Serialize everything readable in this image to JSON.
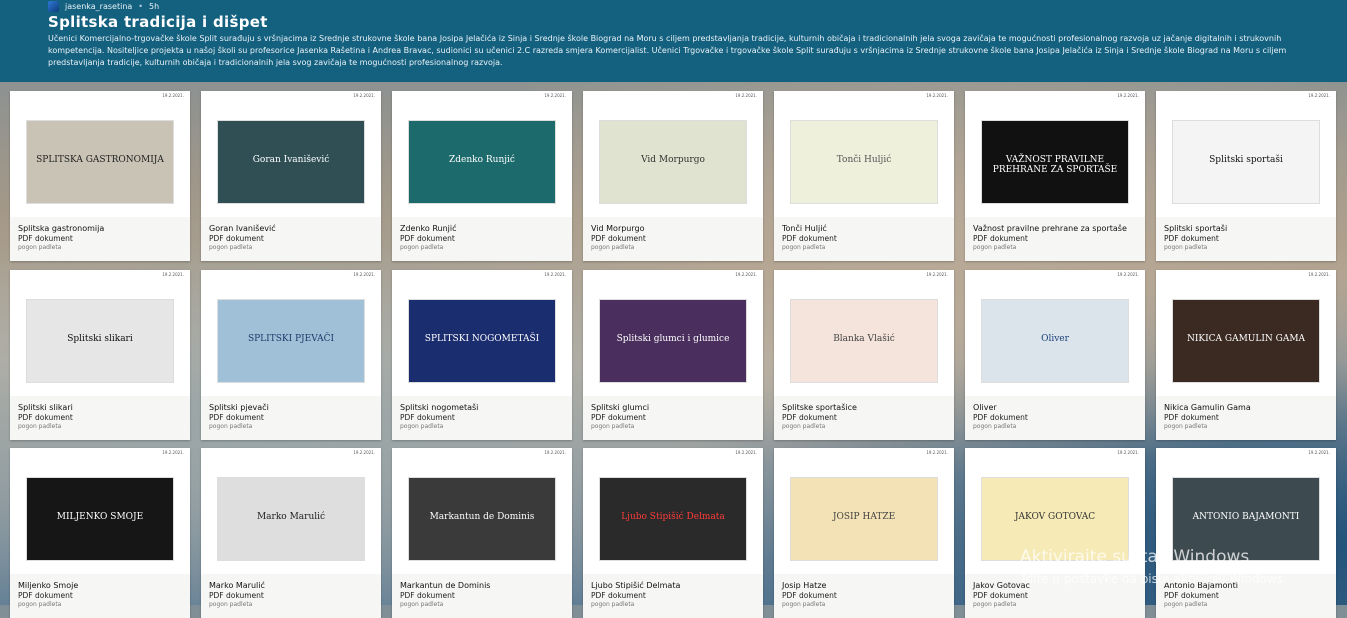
{
  "header": {
    "author": "jasenka_rasetina",
    "time": "5h",
    "title": "Splitska tradicija i dišpet",
    "description": "Učenici Komercijalno-trgovačke škole Split surađuju s vršnjacima iz Srednje strukovne škole bana Josipa Jelačića iz Sinja i Srednje škole Biograd na Moru s ciljem predstavljanja tradicije, kulturnih običaja i tradicionalnih jela svoga zavičaja te mogućnosti profesionalnog razvoja uz jačanje digitalnih i strukovnih kompetencija. Nositeljice projekta u našoj školi su profesorice Jasenka Rašetina i Andrea Bravac, sudionici su učenici 2.C razreda smjera Komercijalist. Učenici Trgovačke i trgovačke škole Split surađuju s vršnjacima iz Srednje strukovne škole bana Josipa Jelačića iz Sinja i Srednje škole Biograd na Moru s ciljem predstavljanja tradicije, kulturnih običaja i tradicionalnih jela svog zavičaja te mogućnosti profesionalnog razvoja."
  },
  "cards": [
    {
      "title": "Splitska gastronomija",
      "type": "PDF dokument",
      "source": "pogon padleta",
      "date": "19.2.2021.",
      "thumb_text": "SPLITSKA GASTRONOMIJA",
      "thumb_bg": "#c9c3b5",
      "thumb_fg": "#222"
    },
    {
      "title": "Goran Ivanišević",
      "type": "PDF dokument",
      "source": "pogon padleta",
      "date": "19.2.2021.",
      "thumb_text": "Goran Ivanišević",
      "thumb_bg": "#2f4f55",
      "thumb_fg": "#fff"
    },
    {
      "title": "Zdenko Runjić",
      "type": "PDF dokument",
      "source": "pogon padleta",
      "date": "19.2.2021.",
      "thumb_text": "Zdenko Runjić",
      "thumb_bg": "#1d6a6c",
      "thumb_fg": "#fff"
    },
    {
      "title": "Vid Morpurgo",
      "type": "PDF dokument",
      "source": "pogon padleta",
      "date": "19.2.2021.",
      "thumb_text": "Vid Morpurgo",
      "thumb_bg": "#dfe3cf",
      "thumb_fg": "#333"
    },
    {
      "title": "Tonči Huljić",
      "type": "PDF dokument",
      "source": "pogon padleta",
      "date": "19.2.2021.",
      "thumb_text": "Tonči Huljić",
      "thumb_bg": "#eef0dc",
      "thumb_fg": "#555"
    },
    {
      "title": "Važnost pravilne prehrane za sportaše",
      "type": "PDF dokument",
      "source": "pogon padleta",
      "date": "19.2.2021.",
      "thumb_text": "VAŽNOST PRAVILNE PREHRANE ZA SPORTAŠE",
      "thumb_bg": "#111",
      "thumb_fg": "#fff"
    },
    {
      "title": "Splitski sportaši",
      "type": "PDF dokument",
      "source": "pogon padleta",
      "date": "19.2.2021.",
      "thumb_text": "Splitski sportaši",
      "thumb_bg": "#f4f4f4",
      "thumb_fg": "#111"
    },
    {
      "title": "Splitski slikari",
      "type": "PDF dokument",
      "source": "pogon padleta",
      "date": "19.2.2021.",
      "thumb_text": "Splitski slikari",
      "thumb_bg": "#e6e6e6",
      "thumb_fg": "#111"
    },
    {
      "title": "Splitski pjevači",
      "type": "PDF dokument",
      "source": "pogon padleta",
      "date": "19.2.2021.",
      "thumb_text": "SPLITSKI PJEVAČI",
      "thumb_bg": "#9fc0d6",
      "thumb_fg": "#1b3c6b"
    },
    {
      "title": "Splitski nogometaši",
      "type": "PDF dokument",
      "source": "pogon padleta",
      "date": "19.2.2021.",
      "thumb_text": "SPLITSKI NOGOMETAŠI",
      "thumb_bg": "#1a2d6e",
      "thumb_fg": "#fff"
    },
    {
      "title": "Splitski glumci",
      "type": "PDF dokument",
      "source": "pogon padleta",
      "date": "19.2.2021.",
      "thumb_text": "Splitski glumci i glumice",
      "thumb_bg": "#4a2f5e",
      "thumb_fg": "#fff"
    },
    {
      "title": "Splitske sportašice",
      "type": "PDF dokument",
      "source": "pogon padleta",
      "date": "19.2.2021.",
      "thumb_text": "Blanka Vlašić",
      "thumb_bg": "#f4e4dc",
      "thumb_fg": "#444"
    },
    {
      "title": "Oliver",
      "type": "PDF dokument",
      "source": "pogon padleta",
      "date": "19.2.2021.",
      "thumb_text": "Oliver",
      "thumb_bg": "#dbe4ea",
      "thumb_fg": "#1c3f79"
    },
    {
      "title": "Nikica Gamulin Gama",
      "type": "PDF dokument",
      "source": "pogon padleta",
      "date": "19.2.2021.",
      "thumb_text": "NIKICA GAMULIN GAMA",
      "thumb_bg": "#3b2a22",
      "thumb_fg": "#fff"
    },
    {
      "title": "Miljenko Smoje",
      "type": "PDF dokument",
      "source": "pogon padleta",
      "date": "19.2.2021.",
      "thumb_text": "MILJENKO SMOJE",
      "thumb_bg": "#161616",
      "thumb_fg": "#fff"
    },
    {
      "title": "Marko Marulić",
      "type": "PDF dokument",
      "source": "pogon padleta",
      "date": "19.2.2021.",
      "thumb_text": "Marko Marulić",
      "thumb_bg": "#dedede",
      "thumb_fg": "#222"
    },
    {
      "title": "Markantun de Dominis",
      "type": "PDF dokument",
      "source": "pogon padleta",
      "date": "19.2.2021.",
      "thumb_text": "Markantun de Dominis",
      "thumb_bg": "#3a3a3a",
      "thumb_fg": "#fff"
    },
    {
      "title": "Ljubo Stipišić Delmata",
      "type": "PDF dokument",
      "source": "pogon padleta",
      "date": "19.2.2021.",
      "thumb_text": "Ljubo Stipišić Delmata",
      "thumb_bg": "#2a2a2a",
      "thumb_fg": "#ff3b3b"
    },
    {
      "title": "Josip Hatze",
      "type": "PDF dokument",
      "source": "pogon padleta",
      "date": "19.2.2021.",
      "thumb_text": "JOSIP HATZE",
      "thumb_bg": "#f3e2b5",
      "thumb_fg": "#444"
    },
    {
      "title": "Jakov Gotovac",
      "type": "PDF dokument",
      "source": "pogon padleta",
      "date": "19.2.2021.",
      "thumb_text": "JAKOV GOTOVAC",
      "thumb_bg": "#f6ebb6",
      "thumb_fg": "#333"
    },
    {
      "title": "Antonio Bajamonti",
      "type": "PDF dokument",
      "source": "pogon padleta",
      "date": "19.2.2021.",
      "thumb_text": "ANTONIO BAJAMONTI",
      "thumb_bg": "#3d4a4f",
      "thumb_fg": "#fff"
    }
  ],
  "watermark": {
    "line1": "Aktivirajte sustav Windows",
    "line2": "Idite u postavke da biste aktivirali Windows."
  }
}
